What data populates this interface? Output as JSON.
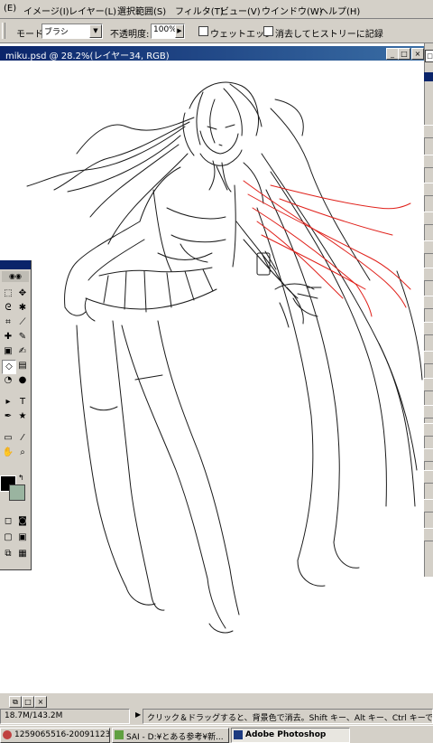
{
  "menu": {
    "file_partial": "(E)",
    "items": [
      "イメージ(I)",
      "レイヤー(L)",
      "選択範囲(S)",
      "フィルタ(T)",
      "ビュー(V)",
      "ウインドウ(W)",
      "ヘルプ(H)"
    ]
  },
  "options": {
    "mode_label": "モード:",
    "mode_value": "ブラシ",
    "opacity_label": "不透明度:",
    "opacity_value": "100%",
    "wet_edge_label": "ウェットエッジ",
    "history_label": "消去してヒストリーに記録"
  },
  "document": {
    "title": "miku.psd @ 28.2%(レイヤー34, RGB)"
  },
  "status": {
    "doc_size": "18.7M/143.2M",
    "hint": "クリック＆ドラッグすると、背景色で消去。Shift キー、Alt キー、Ctrl キーで機能拡張"
  },
  "taskbar": {
    "items": [
      "1259065516-2009112322...",
      "SAI - D:¥とある参考¥新...",
      "Adobe Photoshop"
    ]
  },
  "colors": {
    "title_active": "#0a246a",
    "face": "#d4d0c8",
    "sketch_line": "#1a1a1a",
    "hair_red": "#e0201a",
    "background_swatch": "#9ab4a0"
  },
  "icons": [
    "close-icon",
    "minimize-icon",
    "maximize-icon",
    "marquee-icon",
    "move-icon",
    "lasso-icon",
    "magic-wand-icon",
    "crop-icon",
    "eyedropper-icon",
    "brush-icon",
    "stamp-icon",
    "eraser-icon",
    "gradient-icon",
    "blur-icon",
    "dodge-icon",
    "text-icon",
    "custom-shape-icon",
    "hand-icon",
    "zoom-icon"
  ]
}
